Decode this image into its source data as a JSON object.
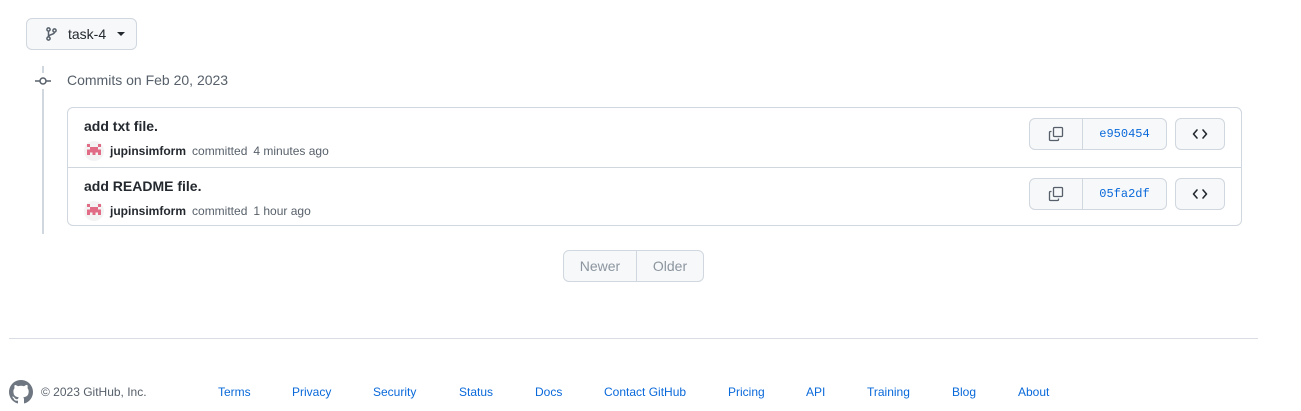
{
  "branch": {
    "name": "task-4",
    "icon": "git-branch-icon"
  },
  "commits_heading": "Commits on Feb 20, 2023",
  "commits": [
    {
      "message": "add txt file.",
      "author": "jupinsimform",
      "verb": "committed",
      "time": "4 minutes ago",
      "sha": "e950454"
    },
    {
      "message": "add README file.",
      "author": "jupinsimform",
      "verb": "committed",
      "time": "1 hour ago",
      "sha": "05fa2df"
    }
  ],
  "pagination": {
    "newer": "Newer",
    "older": "Older"
  },
  "footer": {
    "copyright": "© 2023 GitHub, Inc.",
    "links": [
      "Terms",
      "Privacy",
      "Security",
      "Status",
      "Docs",
      "Contact GitHub",
      "Pricing",
      "API",
      "Training",
      "Blog",
      "About"
    ]
  },
  "colors": {
    "link": "#0969da",
    "border": "#d0d7de",
    "muted": "#57606a",
    "button_bg": "#f6f8fa"
  }
}
